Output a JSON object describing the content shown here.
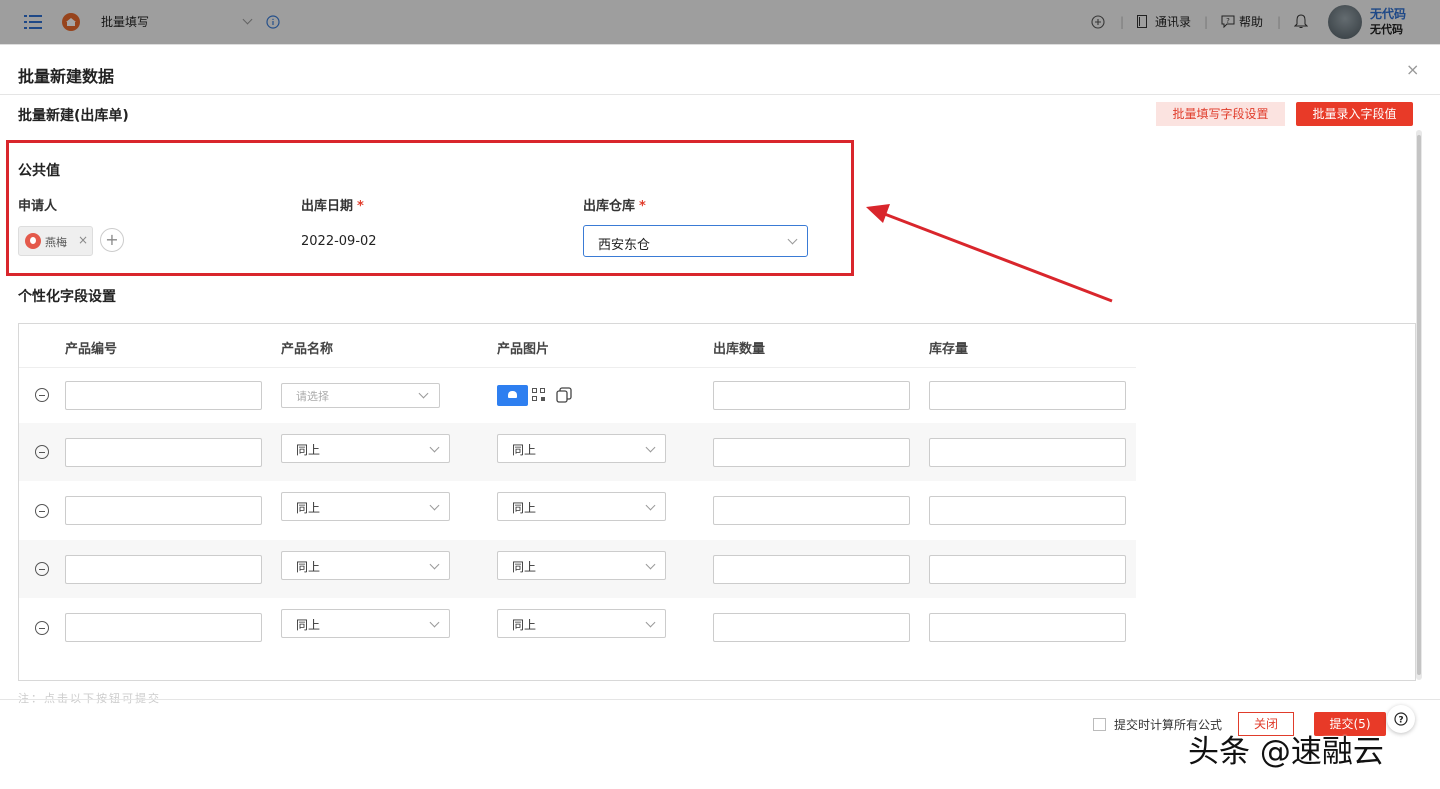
{
  "topbar": {
    "app_title": "批量填写",
    "contacts": "通讯录",
    "help": "帮助",
    "user_name": "无代码",
    "user_sub": "无代码"
  },
  "modal": {
    "title": "批量新建数据",
    "close": "×",
    "subtitle": "批量新建(出库单)",
    "btn_field_settings": "批量填写字段设置",
    "btn_batch_entry": "批量录入字段值"
  },
  "public": {
    "section_title": "公共值",
    "applicant_label": "申请人",
    "applicant_name": "燕梅",
    "tag_remove": "×",
    "add": "+",
    "date_label": "出库日期",
    "date_value": "2022-09-02",
    "warehouse_label": "出库仓库",
    "warehouse_value": "西安东仓",
    "required_mark": "*"
  },
  "custom": {
    "section_title": "个性化字段设置",
    "columns": [
      "产品编号",
      "产品名称",
      "产品图片",
      "出库数量",
      "库存量"
    ],
    "select_placeholder": "请选择",
    "same_as_above": "同上"
  },
  "footer": {
    "faded_text": "注：点击以下按钮可提交",
    "checkbox_label": "提交时计算所有公式",
    "close_btn": "关闭",
    "submit_btn": "提交(5)",
    "help": "?"
  },
  "watermark": "头条 @速融云",
  "colors": {
    "accent_red": "#e83a28",
    "highlight_box": "#d9262c",
    "blue": "#2e7ff0"
  }
}
